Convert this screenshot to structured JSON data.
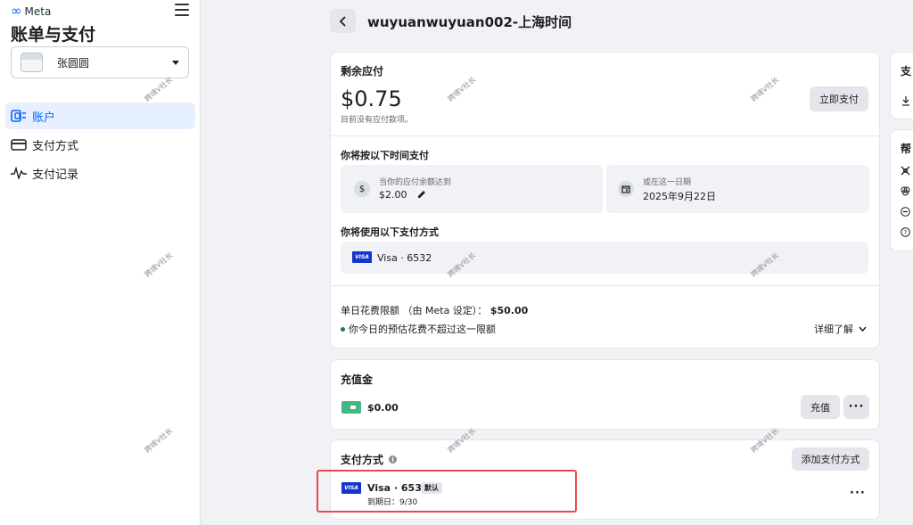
{
  "sidebar": {
    "brand": "Meta",
    "title": "账单与支付",
    "account_name": "张圆圆",
    "items": [
      {
        "label": "账户"
      },
      {
        "label": "支付方式"
      },
      {
        "label": "支付记录"
      }
    ]
  },
  "header": {
    "title": "wuyuanwuyuan002-上海时间"
  },
  "balance": {
    "heading": "剩余应付",
    "amount": "$0.75",
    "subtext": "目前没有应付款项。",
    "pay_now_label": "立即支付",
    "schedule_heading": "你将按以下时间支付",
    "threshold_label": "当你的应付余额达到",
    "threshold_value": "$2.00",
    "date_label": "或在这一日期",
    "date_value": "2025年9月22日",
    "method_heading": "你将使用以下支付方式",
    "method_value": "Visa · 6532",
    "limit_text": "单日花费限额 （由 Meta 设定）：",
    "limit_value": "$50.00",
    "limit_note": "你今日的预估花费不超过这一限额",
    "learn_more": "详细了解"
  },
  "prepaid": {
    "heading": "充值金",
    "amount": "$0.00",
    "recharge_label": "充值",
    "more": "···"
  },
  "payment_methods": {
    "heading": "支付方式",
    "info_icon": "i",
    "add_label": "添加支付方式",
    "card_name": "Visa · 6532",
    "default_badge": "默认",
    "expiry": "到期日：9/30",
    "more": "···"
  },
  "right_panel": {
    "card1_title": "支",
    "card2_title": "帮"
  },
  "visa_text": "VISA",
  "watermark": "跨境V社长",
  "colors": {
    "accent": "#0866ff",
    "highlight_border": "#e84a4a",
    "visa_blue": "#1434cb",
    "prepaid_green": "#42b883",
    "status_green": "#1a7f37"
  }
}
